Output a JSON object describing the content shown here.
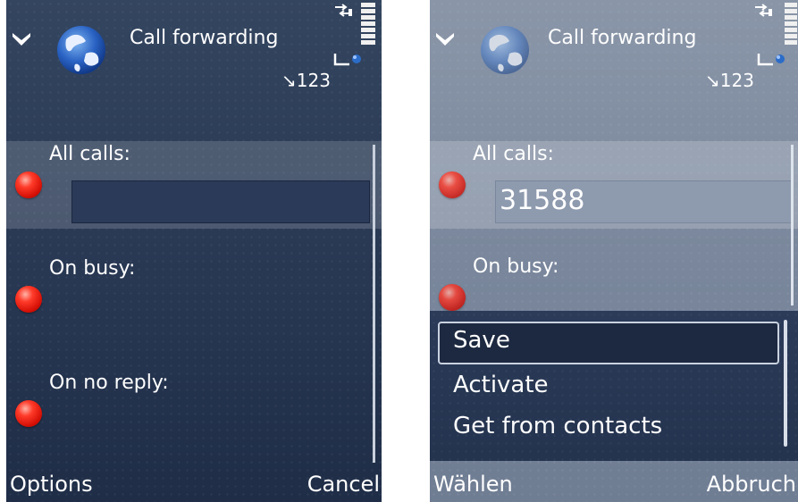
{
  "left_screen": {
    "title": "Call forwarding",
    "indicator_text": "123",
    "fields": [
      {
        "label": "All calls:",
        "value": ""
      },
      {
        "label": "On busy:"
      },
      {
        "label": "On no reply:"
      }
    ],
    "softkeys": {
      "left": "Options",
      "right": "Cancel"
    }
  },
  "right_screen": {
    "title": "Call forwarding",
    "indicator_text": "123",
    "fields": [
      {
        "label": "All calls:",
        "value": "31588"
      },
      {
        "label": "On busy:"
      }
    ],
    "menu": {
      "items": [
        "Save",
        "Activate",
        "Get from contacts"
      ],
      "selected_index": 0
    },
    "softkeys": {
      "left": "Wählen",
      "right": "Abbruch"
    }
  },
  "colors": {
    "selection_dot": "#e01a0c",
    "background_dark": "#2a3a55",
    "background_dimmed": "#7a879c"
  },
  "icons": [
    "navigate-back-icon",
    "globe-icon",
    "signal-strength-icon",
    "battery-icon",
    "pen-input-icon"
  ]
}
